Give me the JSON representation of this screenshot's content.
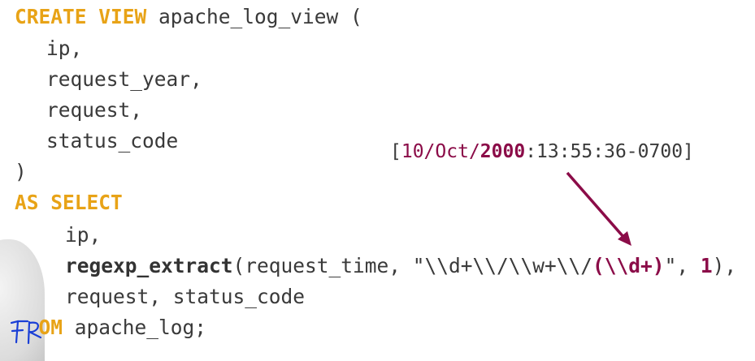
{
  "code": {
    "l1_kw": "CREATE VIEW",
    "l1_rest": " apache_log_view (",
    "l2": "ip,",
    "l3": "request_year,",
    "l4": "request,",
    "l5": "status_code",
    "l6": ")",
    "l7_kw": "AS SELECT",
    "l8": "ip,",
    "l9_fn": "regexp_extract",
    "l9_a": "(request_time, ",
    "l9_str": "\"\\\\d+\\\\/\\\\w+\\\\/",
    "l9_group": "(\\\\d+)",
    "l9_q": "\", ",
    "l9_num": "1",
    "l9_end": "),",
    "l10": "request, status_code",
    "l11_kw": "OM",
    "l11_rest": " apache_log;"
  },
  "annotation": {
    "open": "[",
    "date": "10/Oct/",
    "year": "2000",
    "rest": ":13:55:36-0700]"
  },
  "colors": {
    "keyword": "#e8a317",
    "highlight": "#8b0c48",
    "ink": "#1a3fd6"
  }
}
